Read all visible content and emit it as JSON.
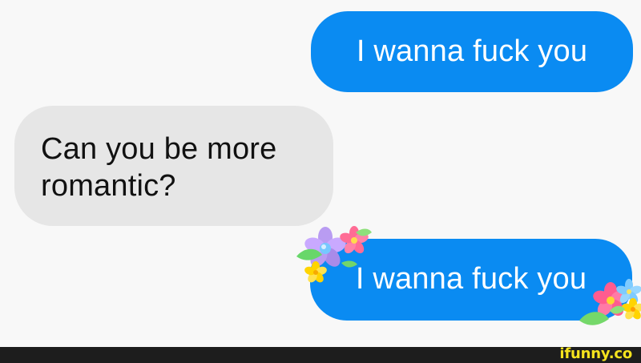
{
  "messages": [
    {
      "sender": "me",
      "text": "I wanna fuck you"
    },
    {
      "sender": "them",
      "text": "Can you be more romantic?"
    },
    {
      "sender": "me",
      "text": "I wanna fuck you"
    }
  ],
  "colors": {
    "sent_bubble": "#0a8bf2",
    "received_bubble": "#e6e6e6",
    "background": "#f8f8f8",
    "footer": "#1d1d1d",
    "watermark": "#f5e31e"
  },
  "decorations": {
    "flower_icon": "flower-icon"
  },
  "watermark": {
    "text": "ifunny.co"
  }
}
